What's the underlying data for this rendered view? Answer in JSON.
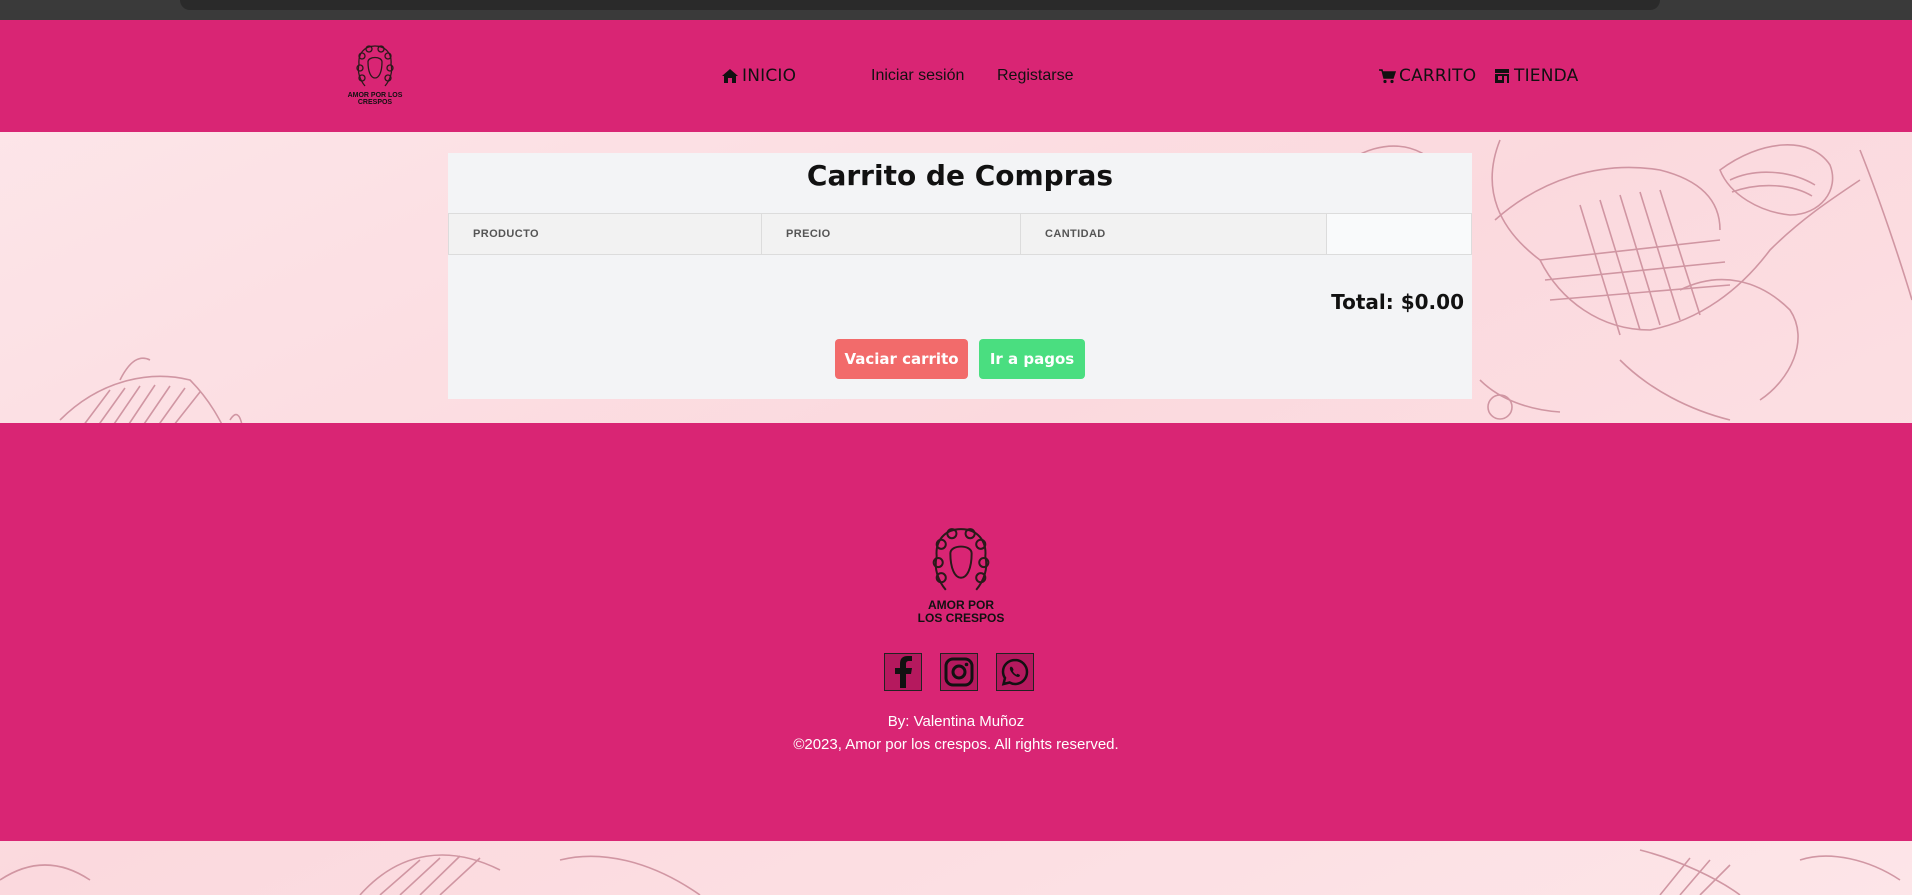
{
  "header": {
    "logo_text": "AMOR POR LOS CRESPOS",
    "nav": {
      "home": "INICIO",
      "login": "Iniciar sesión",
      "register": "Registarse",
      "cart": "CARRITO",
      "store": "TIENDA"
    }
  },
  "cart": {
    "title": "Carrito de Compras",
    "columns": [
      "PRODUCTO",
      "PRECIO",
      "CANTIDAD",
      ""
    ],
    "total_label": "Total: $0.00",
    "empty_button": "Vaciar carrito",
    "checkout_button": "Ir a pagos"
  },
  "footer": {
    "logo_text": "AMOR POR LOS CRESPOS",
    "credit": "By: Valentina Muñoz",
    "copyright": "©2023, Amor por los crespos. All rights reserved."
  },
  "colors": {
    "brand_pink": "#d92574",
    "danger": "#f26b6b",
    "success": "#4ade80"
  }
}
